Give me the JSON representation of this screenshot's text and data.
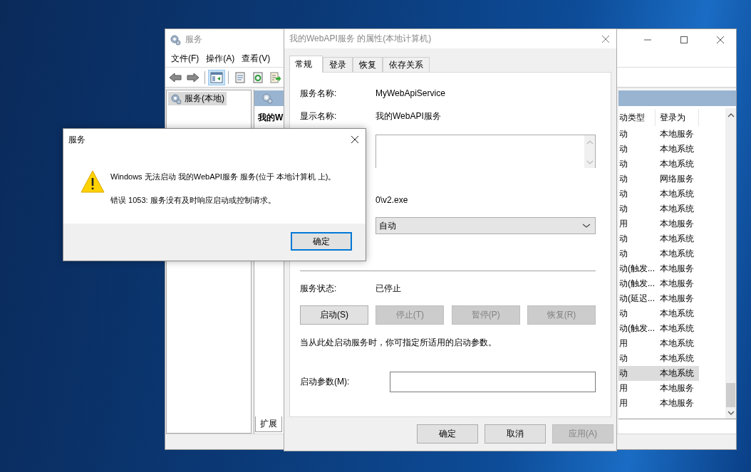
{
  "services_window": {
    "title": "服务",
    "menu": [
      "文件(F)",
      "操作(A)",
      "查看(V)"
    ],
    "toolbar": [
      {
        "kind": "back",
        "selected": false
      },
      {
        "kind": "forward",
        "selected": false
      },
      {
        "kind": "separator"
      },
      {
        "kind": "tree",
        "selected": true
      },
      {
        "kind": "separator"
      },
      {
        "kind": "properties",
        "selected": false
      },
      {
        "kind": "refresh",
        "selected": false
      },
      {
        "kind": "export",
        "selected": false
      }
    ],
    "tree": [
      {
        "label": "服务(本地)",
        "selected": true
      }
    ],
    "detail_heading": "我的W",
    "columns": [
      "动类型",
      "登录为"
    ],
    "rows": [
      {
        "startup": "动",
        "logon": "本地服务",
        "selected": false
      },
      {
        "startup": "动",
        "logon": "本地系统",
        "selected": false
      },
      {
        "startup": "动",
        "logon": "本地系统",
        "selected": false
      },
      {
        "startup": "动",
        "logon": "网络服务",
        "selected": false
      },
      {
        "startup": "动",
        "logon": "本地系统",
        "selected": false
      },
      {
        "startup": "动",
        "logon": "本地系统",
        "selected": false
      },
      {
        "startup": "用",
        "logon": "本地服务",
        "selected": false
      },
      {
        "startup": "动",
        "logon": "本地系统",
        "selected": false
      },
      {
        "startup": "动",
        "logon": "本地系统",
        "selected": false
      },
      {
        "startup": "动(触发...",
        "logon": "本地服务",
        "selected": false
      },
      {
        "startup": "动(触发...",
        "logon": "本地服务",
        "selected": false
      },
      {
        "startup": "动(延迟...",
        "logon": "本地服务",
        "selected": false
      },
      {
        "startup": "动",
        "logon": "本地系统",
        "selected": false
      },
      {
        "startup": "动(触发...",
        "logon": "本地系统",
        "selected": false
      },
      {
        "startup": "用",
        "logon": "本地系统",
        "selected": false
      },
      {
        "startup": "动",
        "logon": "本地系统",
        "selected": false
      },
      {
        "startup": "动",
        "logon": "本地系统",
        "selected": true
      },
      {
        "startup": "用",
        "logon": "本地服务",
        "selected": false
      },
      {
        "startup": "用",
        "logon": "本地服务",
        "selected": false
      }
    ],
    "bottom_tabs": [
      {
        "label": "扩展"
      }
    ]
  },
  "properties_window": {
    "title": "我的WebAPI服务 的属性(本地计算机)",
    "tabs": [
      {
        "label": "常规",
        "selected": true
      },
      {
        "label": "登录",
        "selected": false
      },
      {
        "label": "恢复",
        "selected": false
      },
      {
        "label": "依存关系",
        "selected": false
      }
    ],
    "fields": [
      {
        "label": "服务名称:",
        "value": "MyWebApiService"
      },
      {
        "label": "显示名称:",
        "value": "我的WebAPI服务"
      }
    ],
    "path_text": "0\\v2.exe",
    "startup_type": "自动",
    "status_label": "服务状态:",
    "status_value": "已停止",
    "control_buttons": [
      {
        "label": "启动(S)",
        "disabled": false
      },
      {
        "label": "停止(T)",
        "disabled": true
      },
      {
        "label": "暂停(P)",
        "disabled": true
      },
      {
        "label": "恢复(R)",
        "disabled": true
      }
    ],
    "hint": "当从此处启动服务时，你可指定所适用的启动参数。",
    "params_label": "启动参数(M):",
    "buttons": [
      {
        "label": "确定",
        "disabled": false
      },
      {
        "label": "取消",
        "disabled": false
      },
      {
        "label": "应用(A)",
        "disabled": true
      }
    ]
  },
  "error_dialog": {
    "title": "服务",
    "message": "Windows 无法启动 我的WebAPI服务 服务(位于 本地计算机 上)。",
    "detail": "错误 1053: 服务没有及时响应启动或控制请求。",
    "ok_button": "确定"
  }
}
